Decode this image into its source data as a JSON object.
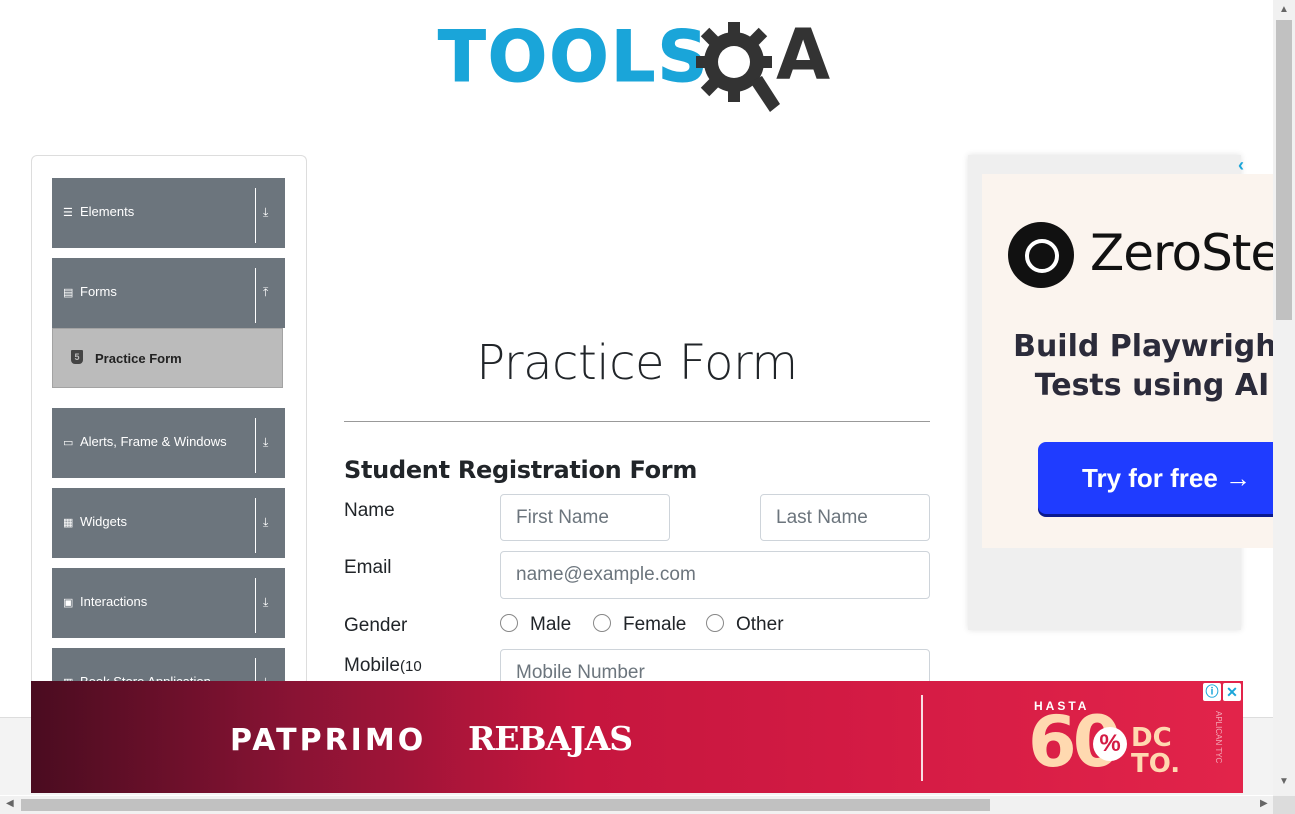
{
  "logo": {
    "text": "TOOLS",
    "letter": "A"
  },
  "sidebar": {
    "groups": [
      {
        "label": "Elements",
        "icon": "hamburger-icon",
        "arrow": "download-arrow-icon"
      },
      {
        "label": "Forms",
        "icon": "form-icon",
        "arrow": "upload-arrow-icon"
      },
      {
        "label": "Alerts, Frame & Windows",
        "icon": "window-icon",
        "arrow": "download-arrow-icon"
      },
      {
        "label": "Widgets",
        "icon": "grid-icon",
        "arrow": "download-arrow-icon"
      },
      {
        "label": "Interactions",
        "icon": "interactions-icon",
        "arrow": "download-arrow-icon"
      },
      {
        "label": "Book Store Application",
        "icon": "book-icon",
        "arrow": "download-arrow-icon"
      }
    ],
    "sub_items": [
      {
        "label": "Practice Form",
        "icon": "html5-icon"
      }
    ]
  },
  "main": {
    "title": "Practice Form",
    "subtitle": "Student Registration Form",
    "name_label": "Name",
    "first_name_placeholder": "First Name",
    "last_name_placeholder": "Last Name",
    "email_label": "Email",
    "email_placeholder": "name@example.com",
    "gender_label": "Gender",
    "gender_options": [
      "Male",
      "Female",
      "Other"
    ],
    "mobile_label": "Mobile",
    "mobile_hint": "(10",
    "mobile_placeholder": "Mobile Number"
  },
  "right_ad": {
    "brand": "ZeroStep",
    "line1": "Build Playwright",
    "line2": "Tests using AI",
    "cta": "Try for free →"
  },
  "banner": {
    "brand": "PATPRIMO",
    "sale": "REBAJAS",
    "hasta": "HASTA",
    "percent_value": "60",
    "percent_sign": "%",
    "dc_line1": "DC",
    "dc_line2": "TO.",
    "vertical_note": "APLICAN TYC"
  },
  "colors": {
    "sidebar_bg": "#6c757d",
    "accent": "#1aa5d9",
    "banner_red": "#d41b44",
    "cta_blue": "#1f3cff"
  }
}
